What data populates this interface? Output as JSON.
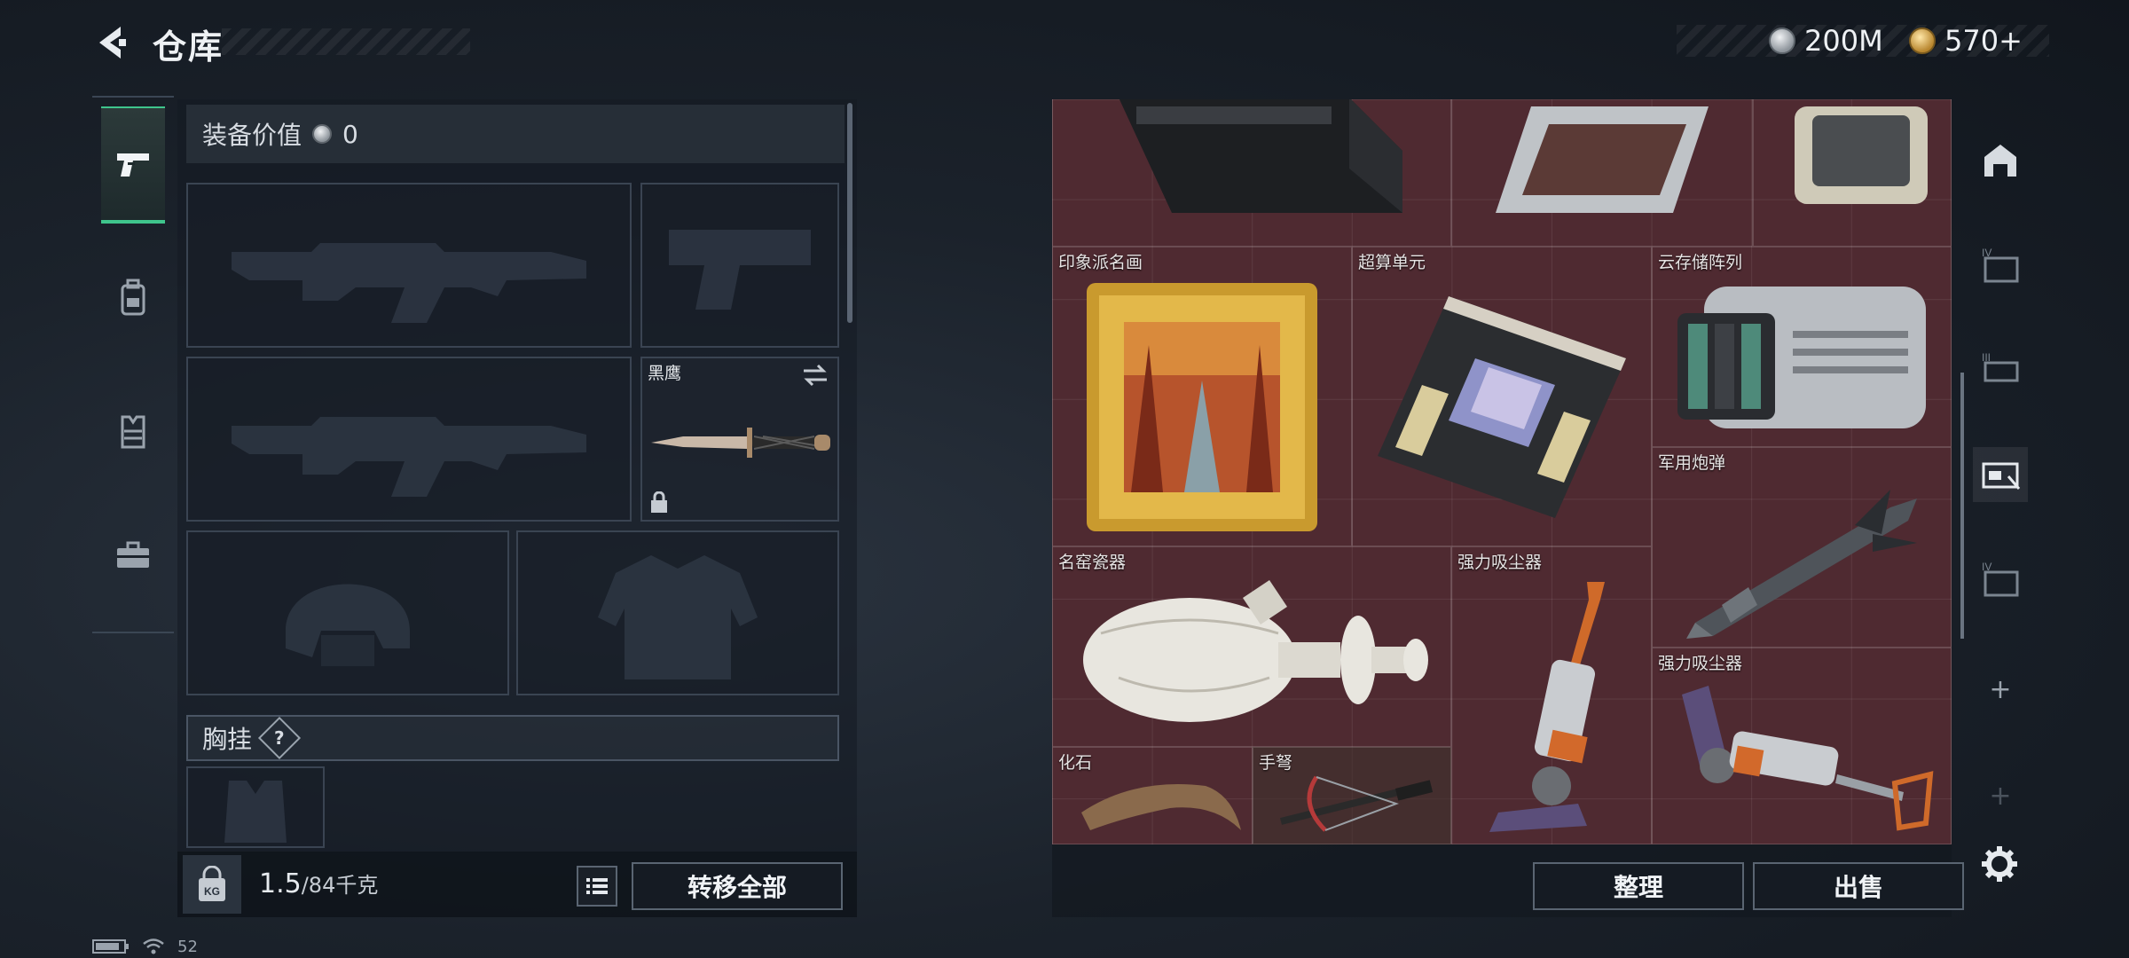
{
  "header": {
    "title": "仓库",
    "currency_silver": "200M",
    "currency_gold": "570+"
  },
  "loadout": {
    "equip_value_label": "装备价值",
    "equip_value": "0",
    "melee_name": "黑鹰",
    "chest_rig_label": "胸挂",
    "help_symbol": "?",
    "weight_current": "1.5",
    "weight_max": "/84千克",
    "kg_tag": "KG",
    "transfer_all": "转移全部"
  },
  "stash": {
    "items": [
      {
        "label": ""
      },
      {
        "label": ""
      },
      {
        "label": ""
      },
      {
        "label": "印象派名画"
      },
      {
        "label": "超算单元"
      },
      {
        "label": "云存储阵列"
      },
      {
        "label": "军用炮弹"
      },
      {
        "label": "名窑瓷器"
      },
      {
        "label": "强力吸尘器"
      },
      {
        "label": "强力吸尘器"
      },
      {
        "label": "化石"
      },
      {
        "label": "手弩"
      }
    ],
    "sort_button": "整理",
    "sell_button": "出售"
  },
  "right_nav": {
    "tab_2": "IV",
    "tab_3": "III",
    "tab_5": "IV",
    "add": "+"
  },
  "status": {
    "signal": "52"
  },
  "colors": {
    "accent_green": "#3fc58c",
    "grid_bg": "#4f2a31"
  }
}
